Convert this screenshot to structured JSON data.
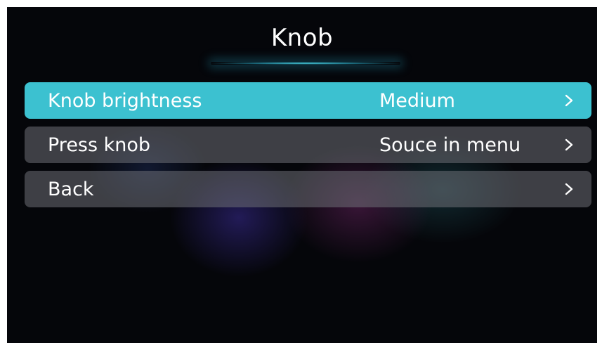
{
  "screen": {
    "title": "Knob"
  },
  "menu": {
    "items": [
      {
        "label": "Knob brightness",
        "value": "Medium",
        "selected": true,
        "icon": "chevron-right-icon"
      },
      {
        "label": "Press knob",
        "value": "Souce in menu",
        "selected": false,
        "icon": "chevron-right-icon"
      },
      {
        "label": "Back",
        "value": "",
        "selected": false,
        "icon": "chevron-right-icon"
      }
    ]
  },
  "colors": {
    "accent": "#3cc1d0",
    "row_background": "#6e7076",
    "background": "#05060a",
    "text": "#ffffff"
  }
}
